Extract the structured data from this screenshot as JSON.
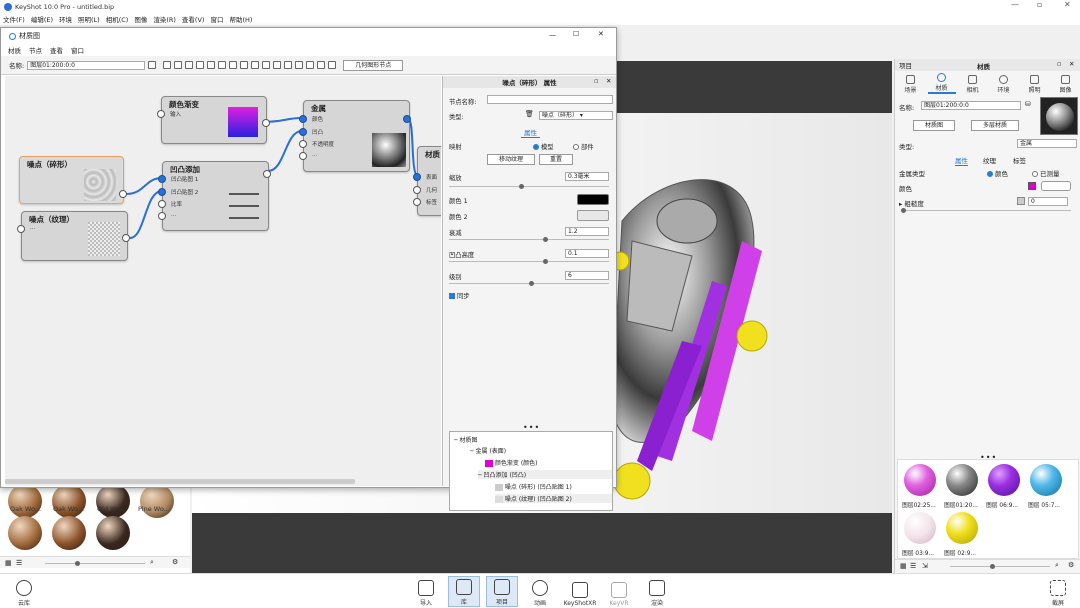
{
  "app": {
    "title": "KeyShot 10.0 Pro  -  untitled.bip",
    "menu": [
      "文件(F)",
      "编辑(E)",
      "环境",
      "照明(L)",
      "相机(C)",
      "图像",
      "渲染(R)",
      "查看(V)",
      "窗口",
      "帮助(H)"
    ]
  },
  "material_window": {
    "title": "材质图",
    "menu": [
      "材质",
      "节点",
      "查看",
      "窗口"
    ],
    "name_label": "名称:",
    "name_value": "图层01:200:0:0",
    "geometry_node_btn": "几何图形节点",
    "nodes": {
      "gradient": {
        "title": "颜色渐变",
        "port": "输入"
      },
      "metal": {
        "title": "金属",
        "ports": [
          "颜色",
          "凹凸",
          "不透明度",
          "..."
        ]
      },
      "material": {
        "title": "材质",
        "ports": [
          "表面",
          "几何",
          "标签"
        ]
      },
      "noise_frac": {
        "title": "噪点（碎形）"
      },
      "bump_add": {
        "title": "凹凸添加",
        "ports": [
          "凹凸贴图 1",
          "凹凸贴图 2",
          "比率",
          "..."
        ]
      },
      "noise_tex": {
        "title": "噪点（纹理）",
        "port": "..."
      }
    },
    "props": {
      "header": "噪点（碎形） 属性",
      "node_name_label": "节点名称:",
      "type_label": "类型:",
      "type_value": "噪点（碎形）",
      "tab": "属性",
      "mapping_label": "映射",
      "mapping_opts": [
        "模型",
        "部件"
      ],
      "move_tex_btn": "移动纹理",
      "reset_btn": "重置",
      "scale_label": "缩放",
      "scale_value": "0.3毫米",
      "color1_label": "颜色 1",
      "color2_label": "颜色 2",
      "decay_label": "衰减",
      "decay_value": "1.2",
      "bump_label": "凹凸高度",
      "bump_value": "0.1",
      "level_label": "级别",
      "level_value": "6",
      "sync_label": "同步"
    },
    "tree": [
      {
        "label": "材质图"
      },
      {
        "label": "金属 (表面)"
      },
      {
        "label": "颜色渐变 (颜色)"
      },
      {
        "label": "凹凸添加 (凹凸)"
      },
      {
        "label": "噪点 (碎形)  (凹凸贴图 1)"
      },
      {
        "label": "噪点 (纹理)  (凹凸贴图 2)"
      }
    ]
  },
  "library": {
    "items": [
      {
        "label": "Oak Wo...",
        "color": "#a06a3a"
      },
      {
        "label": "Oak Wo...",
        "color": "#8a5128"
      },
      {
        "label": "Old Wo...",
        "color": "#3a2820"
      },
      {
        "label": "Pine Wo...",
        "color": "#b08a60"
      }
    ]
  },
  "right_panel": {
    "header_left": "项目",
    "header_center": "材质",
    "tabs": [
      "场景",
      "材质",
      "相机",
      "环境",
      "照明",
      "图像"
    ],
    "name_label": "名称:",
    "name_value": "图层01:200:0:0",
    "btn_graph": "材质图",
    "btn_multi": "多层材质",
    "type_label": "类型:",
    "type_value": "金属",
    "subtabs": [
      "属性",
      "纹理",
      "标签"
    ],
    "metal_type_label": "金属类型",
    "metal_type_opts": [
      "颜色",
      "已测量"
    ],
    "color_label": "颜色",
    "rough_label": "粗糙度",
    "rough_value": "0",
    "swatches": [
      {
        "label": "图层02:25...",
        "color": "#e060e0"
      },
      {
        "label": "图层01:20...",
        "color": "#888888"
      },
      {
        "label": "图层 06:9...",
        "color": "#9a30e0"
      },
      {
        "label": "图层 05:7...",
        "color": "#50b8e8"
      },
      {
        "label": "图层 03:9...",
        "color": "#f3e3ea"
      },
      {
        "label": "图层 02:9...",
        "color": "#f0e020"
      }
    ]
  },
  "bottom": {
    "cloud": "云库",
    "buttons": [
      "导入",
      "库",
      "项目",
      "动画",
      "KeyShotXR",
      "KeyVR",
      "渲染"
    ],
    "right": "截屏"
  }
}
